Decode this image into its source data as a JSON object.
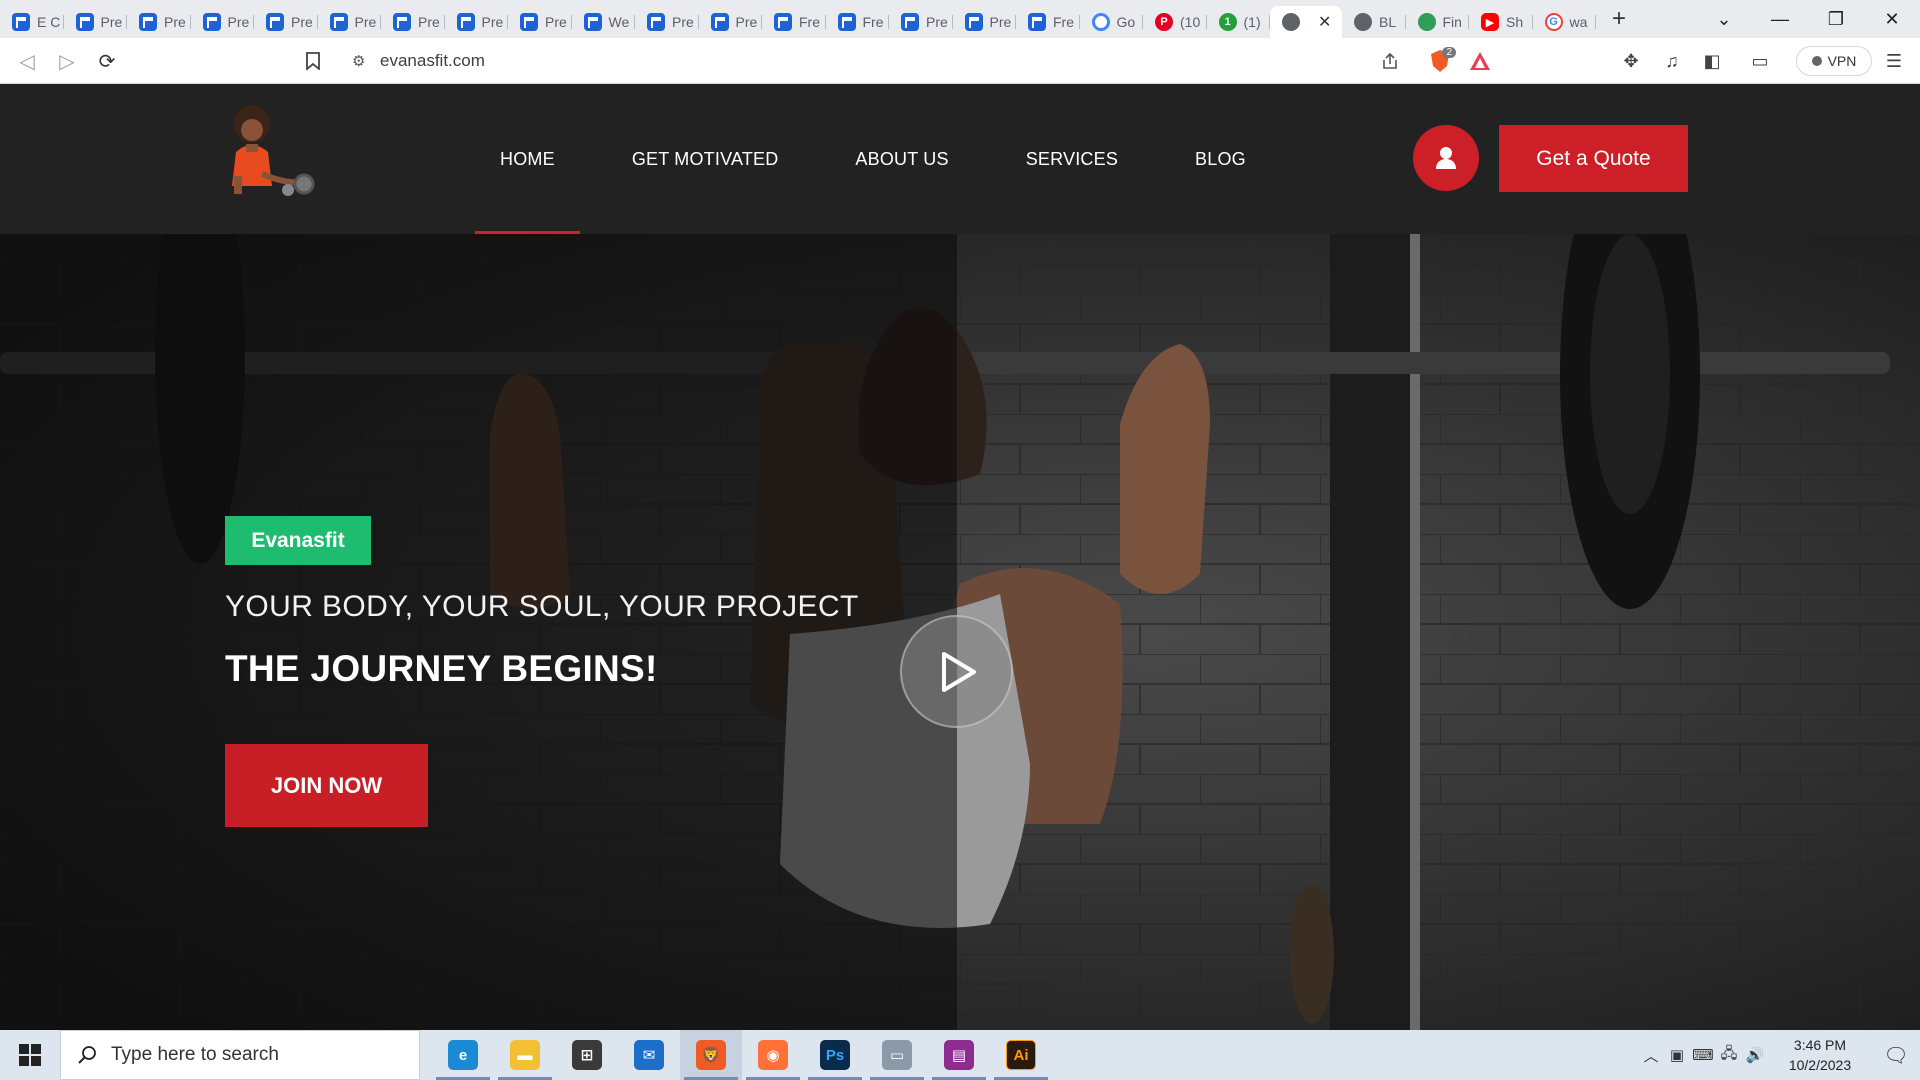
{
  "browser": {
    "tabs": [
      {
        "icon": "doc-icon",
        "label": "E C"
      },
      {
        "icon": "doc-icon",
        "label": "Pre"
      },
      {
        "icon": "doc-icon",
        "label": "Pre"
      },
      {
        "icon": "doc-icon",
        "label": "Pre"
      },
      {
        "icon": "doc-icon",
        "label": "Pre"
      },
      {
        "icon": "doc-icon",
        "label": "Pre"
      },
      {
        "icon": "doc-icon",
        "label": "Pre"
      },
      {
        "icon": "doc-icon",
        "label": "Pre"
      },
      {
        "icon": "doc-icon",
        "label": "Pre"
      },
      {
        "icon": "doc-icon",
        "label": "We"
      },
      {
        "icon": "doc-icon",
        "label": "Pre"
      },
      {
        "icon": "doc-icon",
        "label": "Pre"
      },
      {
        "icon": "doc-icon",
        "label": "Fre"
      },
      {
        "icon": "doc-icon",
        "label": "Fre"
      },
      {
        "icon": "doc-icon",
        "label": "Pre"
      },
      {
        "icon": "doc-icon",
        "label": "Pre"
      },
      {
        "icon": "doc-icon",
        "label": "Fre"
      },
      {
        "icon": "google-lens-icon",
        "label": "Go"
      },
      {
        "icon": "pinterest-icon",
        "label": "(10"
      },
      {
        "icon": "green-one-icon",
        "label": "(1)"
      },
      {
        "icon": "globe-icon",
        "label": "",
        "active": true
      },
      {
        "icon": "globe-icon",
        "label": "BL"
      },
      {
        "icon": "earth-icon",
        "label": "Fin"
      },
      {
        "icon": "youtube-icon",
        "label": "Sh"
      },
      {
        "icon": "google-icon",
        "label": "wa"
      }
    ],
    "url": "evanasfit.com",
    "brave_badge": "2",
    "vpn_label": "VPN"
  },
  "site": {
    "nav": [
      {
        "label": "HOME",
        "active": true
      },
      {
        "label": "GET MOTIVATED"
      },
      {
        "label": "ABOUT US"
      },
      {
        "label": "SERVICES"
      },
      {
        "label": "BLOG"
      }
    ],
    "quote_button": "Get a Quote",
    "hero": {
      "badge": "Evanasfit",
      "tagline": "YOUR BODY, YOUR SOUL, YOUR PROJECT",
      "headline": "THE JOURNEY BEGINS!",
      "cta": "JOIN NOW"
    },
    "colors": {
      "accent_red": "#cc1f27",
      "badge_green": "#1ebc6e",
      "header_bg": "#222222"
    }
  },
  "taskbar": {
    "search_placeholder": "Type here to search",
    "apps": [
      "edge-icon",
      "file-explorer-icon",
      "store-icon",
      "mail-icon",
      "brave-icon",
      "firefox-icon",
      "photoshop-icon",
      "drive-icon",
      "winrar-icon",
      "illustrator-icon"
    ],
    "time": "3:46 PM",
    "date": "10/2/2023"
  }
}
